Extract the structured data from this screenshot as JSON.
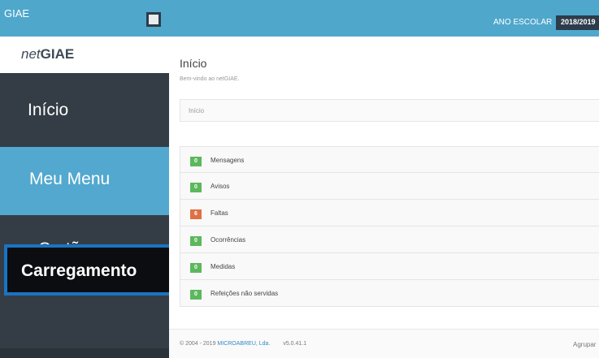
{
  "topbar": {
    "brand": "GIAE",
    "year_label": "ANO ESCOLAR",
    "year_value": "2018/2019"
  },
  "sidebar": {
    "logo_net": "net",
    "logo_giae": "GIAE",
    "items": [
      {
        "label": "Início"
      },
      {
        "label": "Meu Menu"
      },
      {
        "label": "Cartão"
      },
      {
        "label": "Carregamento"
      }
    ]
  },
  "main": {
    "title": "Início",
    "subtitle": "Bem-vindo ao netGIAE.",
    "breadcrumb": "Início",
    "rows": [
      {
        "count": "0",
        "label": "Mensagens",
        "color": "#5cb85c"
      },
      {
        "count": "0",
        "label": "Avisos",
        "color": "#5cb85c"
      },
      {
        "count": "6",
        "label": "Faltas",
        "color": "#e07043"
      },
      {
        "count": "0",
        "label": "Ocorrências",
        "color": "#5cb85c"
      },
      {
        "count": "0",
        "label": "Medidas",
        "color": "#5cb85c"
      },
      {
        "count": "0",
        "label": "Refeições não servidas",
        "color": "#5cb85c"
      }
    ]
  },
  "footer": {
    "copyright": "© 2004 - 2019",
    "company": "MICROABREU, Lda.",
    "version": "v5.0.41.1",
    "right_text": "Agrupar"
  },
  "colors": {
    "topbar": "#4fa7cc",
    "sidebar": "#343d45",
    "active_item": "#52a8cf",
    "highlight_border": "#1a74c2"
  }
}
